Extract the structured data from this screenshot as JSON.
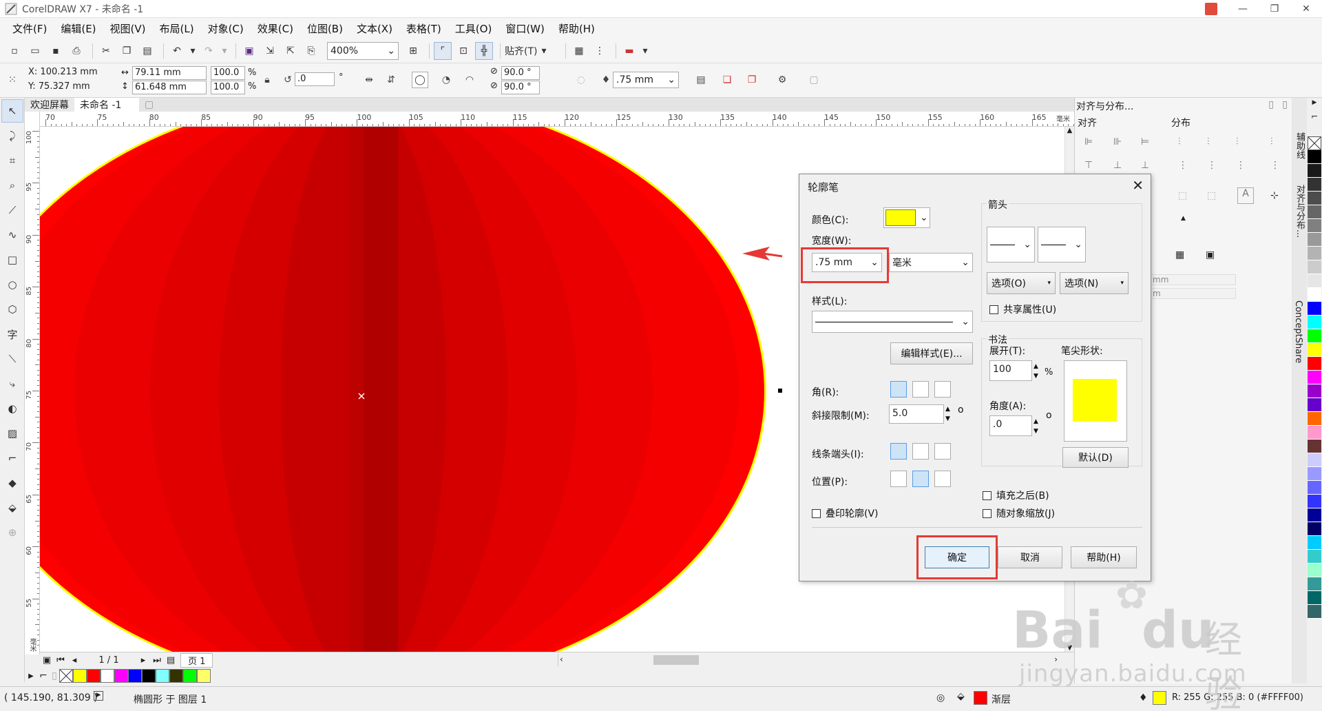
{
  "window": {
    "title": "CorelDRAW X7 - 未命名 -1",
    "controls": [
      "—",
      "❐",
      "✕"
    ]
  },
  "menu": [
    "文件(F)",
    "编辑(E)",
    "视图(V)",
    "布局(L)",
    "对象(C)",
    "效果(C)",
    "位图(B)",
    "文本(X)",
    "表格(T)",
    "工具(O)",
    "窗口(W)",
    "帮助(H)"
  ],
  "toolbar": {
    "zoom": "400%",
    "snap_label": "贴齐(T)"
  },
  "propbar": {
    "x": "X: 100.213 mm",
    "y": "Y: 75.327 mm",
    "w": "79.11 mm",
    "h": "61.648 mm",
    "sx": "100.0",
    "sy": "100.0",
    "pct": "%",
    "rot": ".0",
    "deg": "°",
    "a1": "90.0 °",
    "a2": "90.0 °",
    "outline": ".75 mm"
  },
  "tabs": [
    "欢迎屏幕",
    "未命名 -1"
  ],
  "ruler_h": [
    "70",
    "75",
    "80",
    "85",
    "90",
    "95",
    "100",
    "105",
    "110",
    "115",
    "120",
    "125",
    "130",
    "135",
    "140",
    "145",
    "150",
    "155",
    "160",
    "165"
  ],
  "ruler_h_unit": "毫米",
  "ruler_v": [
    "100",
    "95",
    "90",
    "85",
    "80",
    "75",
    "70",
    "65",
    "60",
    "55"
  ],
  "ruler_v_unit": "毫米",
  "pages": {
    "count": "1 / 1",
    "tab": "页 1"
  },
  "status": {
    "coords": "( 145.190, 81.309 )",
    "object": "椭圆形 于 图层 1",
    "fill": "渐层",
    "outline": "R: 255 G: 255 B: 0 (#FFFF00)"
  },
  "panel": {
    "title": "对齐与分布...",
    "align": "对齐",
    "distribute": "分布",
    "field1": "mm",
    "field2": "m"
  },
  "dock_tabs": [
    "辅助线",
    "对齐与分布...",
    "ConceptShare"
  ],
  "dialog": {
    "title": "轮廓笔",
    "color_label": "颜色(C):",
    "width_label": "宽度(W):",
    "width_value": ".75 mm",
    "unit_value": "毫米",
    "style_label": "样式(L):",
    "edit_style": "编辑样式(E)...",
    "corner_label": "角(R):",
    "miter_label": "斜接限制(M):",
    "miter_value": "5.0",
    "miter_unit": "o",
    "cap_label": "线条端头(I):",
    "pos_label": "位置(P):",
    "overprint": "叠印轮廓(V)",
    "arrows": "箭头",
    "opt1": "选项(O)",
    "opt2": "选项(N)",
    "share": "共享属性(U)",
    "calligraphy": "书法",
    "stretch_label": "展开(T):",
    "stretch_value": "100",
    "stretch_unit": "%",
    "nib_label": "笔尖形状:",
    "angle_label": "角度(A):",
    "angle_value": ".0",
    "angle_unit": "o",
    "default": "默认(D)",
    "fill_behind": "填充之后(B)",
    "scale": "随对象缩放(J)",
    "ok": "确定",
    "cancel": "取消",
    "help": "帮助(H)"
  },
  "colors": {
    "outline": "#FFFF00",
    "fill_main": "#FF0000",
    "fill_dark": "#B50000",
    "highlight": "#E53935"
  },
  "watermark": {
    "brand": "Bai",
    "du": "du",
    "jingyan": "经验",
    "url": "jingyan.baidu.com"
  }
}
